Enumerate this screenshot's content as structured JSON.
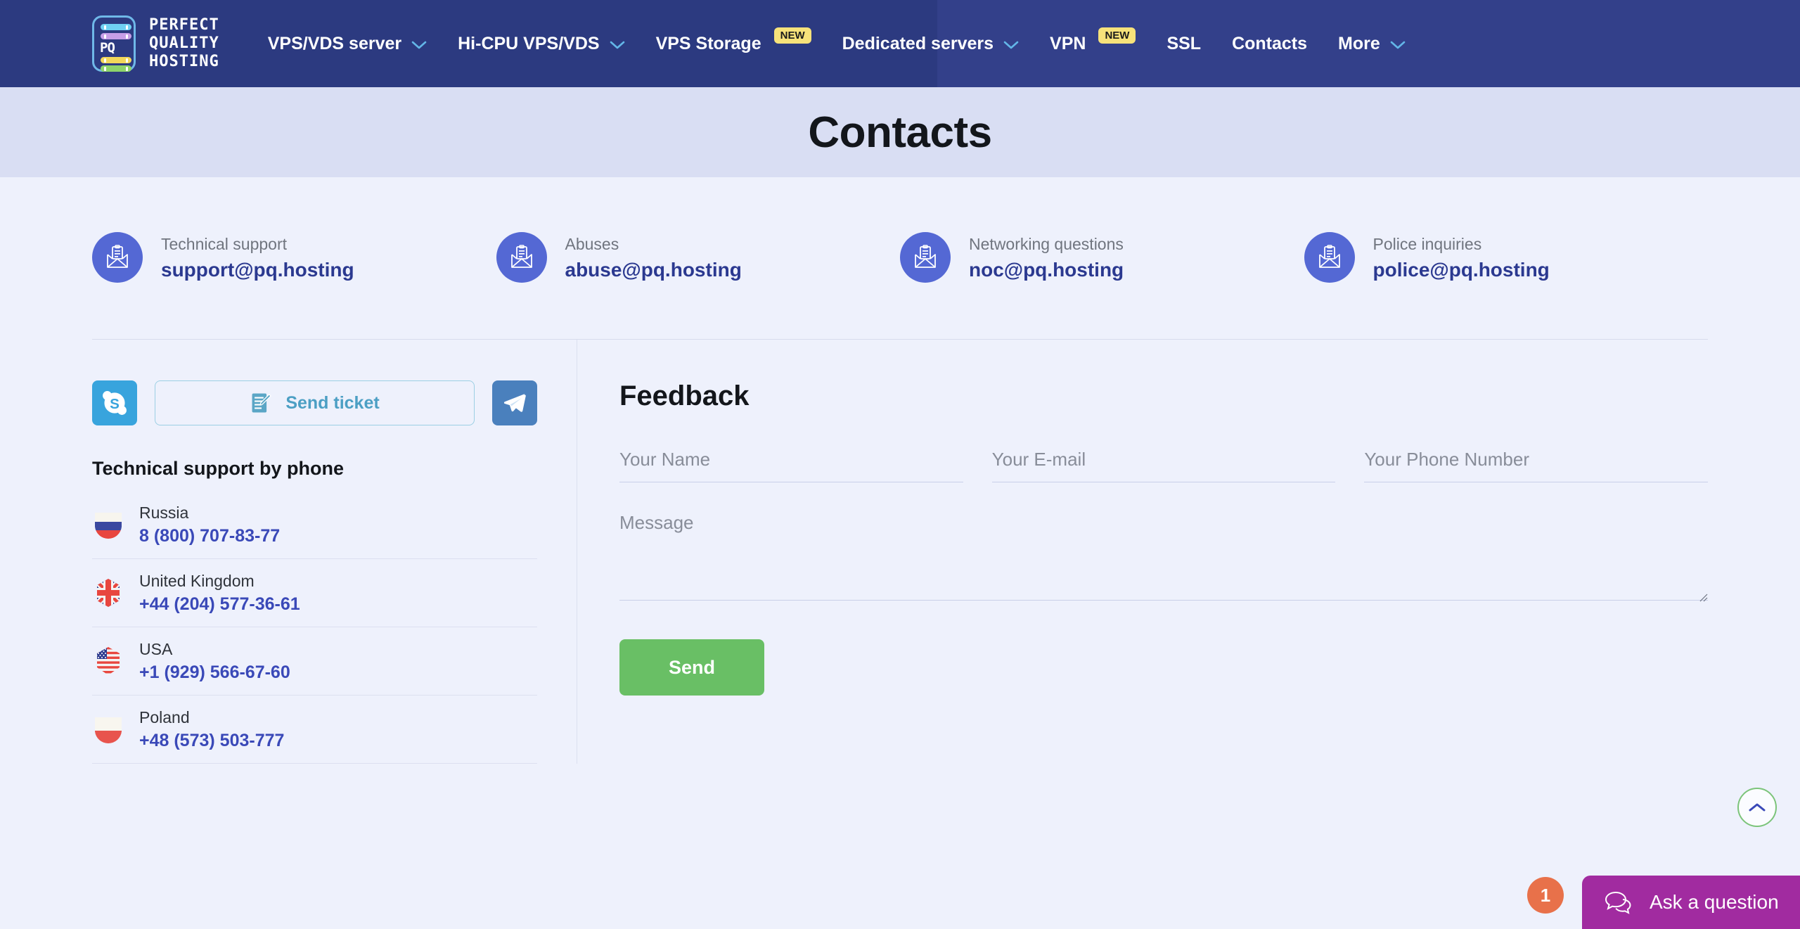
{
  "brand": {
    "logo_line1": "PERFECT",
    "logo_line2": "QUALITY",
    "logo_line3": "HOSTING",
    "logo_mark_text": "PQ",
    "navbar_color": "#2c3a80",
    "accent_color": "#3a49b8"
  },
  "nav": {
    "items": [
      {
        "label": "VPS/VDS server",
        "has_dropdown": true,
        "badge": ""
      },
      {
        "label": "Hi-CPU VPS/VDS",
        "has_dropdown": true,
        "badge": ""
      },
      {
        "label": "VPS Storage",
        "has_dropdown": false,
        "badge": "NEW"
      },
      {
        "label": "Dedicated servers",
        "has_dropdown": true,
        "badge": ""
      },
      {
        "label": "VPN",
        "has_dropdown": false,
        "badge": "NEW"
      },
      {
        "label": "SSL",
        "has_dropdown": false,
        "badge": ""
      },
      {
        "label": "Contacts",
        "has_dropdown": false,
        "badge": ""
      },
      {
        "label": "More",
        "has_dropdown": true,
        "badge": ""
      }
    ]
  },
  "hero": {
    "title": "Contacts",
    "background": "#d9def3"
  },
  "emails": [
    {
      "label": "Technical support",
      "address": "support@pq.hosting",
      "icon": "envelope-icon"
    },
    {
      "label": "Abuses",
      "address": "abuse@pq.hosting",
      "icon": "envelope-icon"
    },
    {
      "label": "Networking questions",
      "address": "noc@pq.hosting",
      "icon": "envelope-icon"
    },
    {
      "label": "Police inquiries",
      "address": "police@pq.hosting",
      "icon": "envelope-icon"
    }
  ],
  "actions": {
    "skype_icon": "skype-icon",
    "ticket_label": "Send ticket",
    "ticket_icon": "ticket-note-icon",
    "telegram_icon": "telegram-icon"
  },
  "phones": {
    "title": "Technical support by phone",
    "items": [
      {
        "country": "Russia",
        "number": "8 (800) 707-83-77",
        "flag": "flag-russia"
      },
      {
        "country": "United Kingdom",
        "number": "+44 (204) 577-36-61",
        "flag": "flag-uk"
      },
      {
        "country": "USA",
        "number": "+1 (929) 566-67-60",
        "flag": "flag-usa"
      },
      {
        "country": "Poland",
        "number": "+48 (573) 503-777",
        "flag": "flag-poland"
      }
    ]
  },
  "feedback": {
    "title": "Feedback",
    "name_placeholder": "Your Name",
    "name_value": "",
    "email_placeholder": "Your E-mail",
    "email_value": "",
    "phone_placeholder": "Your Phone Number",
    "phone_value": "",
    "message_placeholder": "Message",
    "message_value": "",
    "send_label": "Send",
    "send_color": "#69bf65"
  },
  "floating": {
    "scroll_top_icon": "chevron-up-icon",
    "ask_count": "1",
    "ask_label": "Ask a question",
    "ask_icon": "chat-bubbles-icon",
    "ask_color": "#a12ba0",
    "count_color": "#e8714a"
  }
}
